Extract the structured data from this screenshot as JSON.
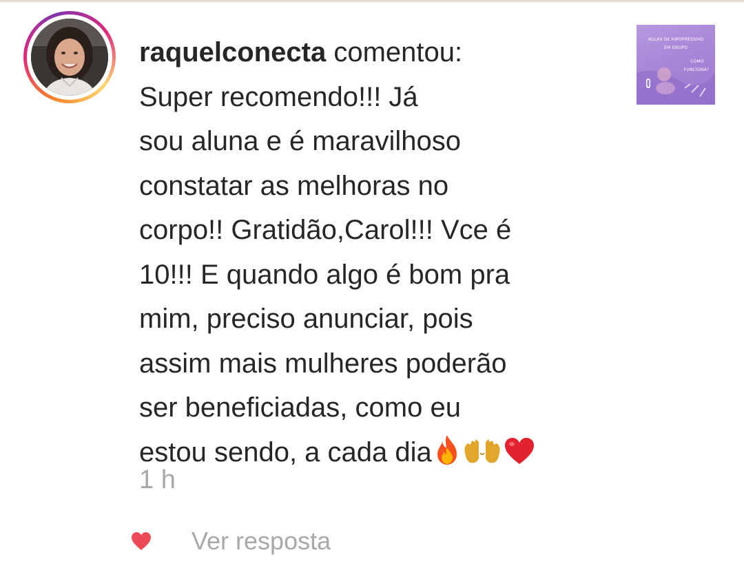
{
  "notification": {
    "username": "raquelconecta",
    "action": "comentou:",
    "comment_lines": [
      "Super recomendo!!! Já",
      "sou aluna e é maravilhoso",
      "constatar as melhoras no",
      "corpo!! Gratidão,Carol!!! Vce é",
      "10!!! E quando algo é bom pra",
      "mim, preciso anunciar, pois",
      "assim mais mulheres poderão",
      "ser beneficiadas, como eu",
      "estou sendo, a cada dia"
    ],
    "emojis": [
      "fire-emoji",
      "raising-hands-emoji",
      "red-heart-emoji"
    ],
    "timestamp": "1 h",
    "reply_label": "Ver resposta"
  },
  "post_thumbnail": {
    "line1": "AULAS DE HIPOPRESSIVO",
    "line2": "EM GRUPO",
    "line3": "COMO",
    "line4": "FUNCIONA?"
  },
  "colors": {
    "text": "#262626",
    "muted": "#a8a8a8",
    "like_heart": "#ed4956",
    "thumbnail_bg": "#a985d8"
  }
}
